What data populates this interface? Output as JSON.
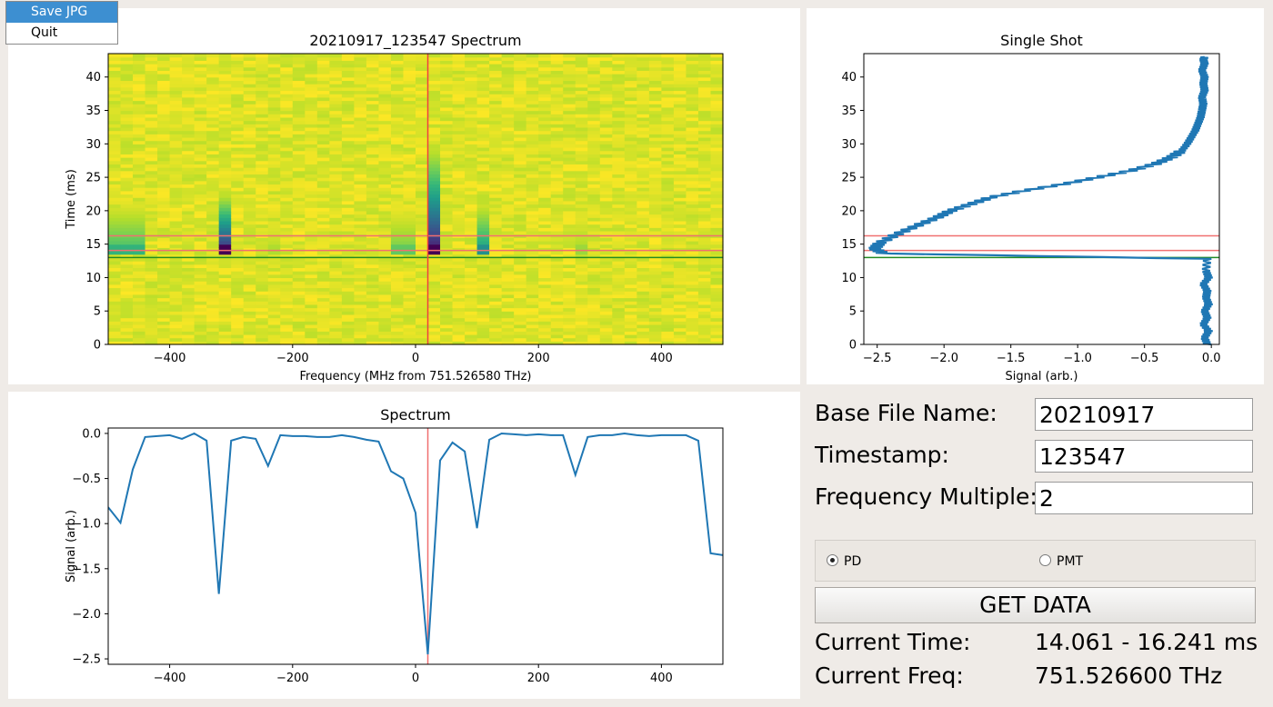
{
  "menu": {
    "items": [
      {
        "label": "Save JPG",
        "active": true
      },
      {
        "label": "Quit",
        "active": false
      }
    ]
  },
  "form": {
    "base_file_name": {
      "label": "Base File Name:",
      "value": "20210917"
    },
    "timestamp": {
      "label": "Timestamp:",
      "value": "123547"
    },
    "frequency_multiple": {
      "label": "Frequency Multiple:",
      "value": "2"
    }
  },
  "detector": {
    "options": [
      {
        "label": "PD",
        "selected": true
      },
      {
        "label": "PMT",
        "selected": false
      }
    ]
  },
  "get_data_label": "GET DATA",
  "status": {
    "time": {
      "label": "Current Time:",
      "value": "14.061 - 16.241 ms"
    },
    "freq": {
      "label": "Current Freq:",
      "value": "751.526600 THz"
    }
  },
  "chart_data": [
    {
      "type": "heatmap",
      "title": "20210917_123547 Spectrum",
      "xlabel": "Frequency (MHz from 751.526580 THz)",
      "ylabel": "Time (ms)",
      "xlim": [
        -500,
        500
      ],
      "ylim": [
        0,
        43.5
      ],
      "xticks": [
        -400,
        -200,
        0,
        200,
        400
      ],
      "yticks": [
        0,
        5,
        10,
        15,
        20,
        25,
        30,
        35,
        40
      ],
      "colormap": "viridis",
      "features": [
        {
          "x_center": -470,
          "width": 40,
          "depth": 0.35,
          "t_end": 23
        },
        {
          "x_center": -310,
          "width": 20,
          "depth": 1.0,
          "t_end": 24
        },
        {
          "x_center": -235,
          "width": 20,
          "depth": 0.12,
          "t_end": 22
        },
        {
          "x_center": -15,
          "width": 40,
          "depth": 0.25,
          "t_end": 22
        },
        {
          "x_center": 25,
          "width": 20,
          "depth": 1.0,
          "t_end": 32
        },
        {
          "x_center": 105,
          "width": 20,
          "depth": 0.5,
          "t_end": 23
        },
        {
          "x_center": 270,
          "width": 20,
          "depth": 0.15,
          "t_end": 22
        }
      ],
      "hlines": [
        {
          "y": 16.24,
          "color": "#f07070"
        },
        {
          "y": 14.06,
          "color": "#f07070"
        },
        {
          "y": 13.0,
          "color": "#228b22"
        }
      ],
      "vlines": [
        {
          "x": 20,
          "color": "#f04040"
        }
      ]
    },
    {
      "type": "line",
      "title": "Single Shot",
      "xlabel": "Signal (arb.)",
      "ylabel": "",
      "xlim": [
        -2.6,
        0.06
      ],
      "ylim": [
        0,
        43.5
      ],
      "xticks": [
        -2.5,
        -2.0,
        -1.5,
        -1.0,
        -0.5,
        0.0
      ],
      "yticks": [
        0,
        5,
        10,
        15,
        20,
        25,
        30,
        35,
        40
      ],
      "series": [
        {
          "x": [
            -0.03,
            -0.05,
            -0.02,
            -0.06,
            -0.03,
            -0.05,
            -0.02,
            -0.04,
            -0.03,
            -0.06,
            -0.02,
            -0.04,
            -0.03,
            -2.45,
            -2.52,
            -2.48,
            -2.35,
            -2.2,
            -2.05,
            -1.95,
            -1.8,
            -1.65,
            -1.4,
            -1.1,
            -0.85,
            -0.6,
            -0.42,
            -0.3,
            -0.22,
            -0.18,
            -0.15,
            -0.12,
            -0.1,
            -0.08,
            -0.07,
            -0.06,
            -0.07,
            -0.05,
            -0.06,
            -0.05,
            -0.07,
            -0.05,
            -0.06,
            -0.05
          ],
          "y": [
            0,
            1,
            2,
            3,
            4,
            5,
            6,
            7,
            8,
            9,
            10,
            11,
            12.8,
            13.6,
            14.3,
            15.2,
            16.5,
            17.8,
            19,
            20,
            21,
            22,
            23,
            24,
            25,
            26,
            27,
            28,
            29,
            30,
            31,
            32,
            33,
            34,
            35,
            36,
            37,
            38,
            39,
            40,
            41,
            42,
            42.6,
            43
          ]
        }
      ],
      "hlines": [
        {
          "y": 16.24,
          "color": "#f07070"
        },
        {
          "y": 14.06,
          "color": "#f07070"
        },
        {
          "y": 13.0,
          "color": "#228b22"
        }
      ]
    },
    {
      "type": "line",
      "title": "Spectrum",
      "xlabel": "",
      "ylabel": "Signal (arb.)",
      "xlim": [
        -500,
        500
      ],
      "ylim": [
        -2.56,
        0.06
      ],
      "xticks": [
        -400,
        -200,
        0,
        200,
        400
      ],
      "yticks": [
        0.0,
        -0.5,
        -1.0,
        -1.5,
        -2.0,
        -2.5
      ],
      "series": [
        {
          "x": [
            -500,
            -480,
            -460,
            -440,
            -420,
            -400,
            -380,
            -360,
            -340,
            -320,
            -300,
            -280,
            -260,
            -240,
            -220,
            -200,
            -180,
            -160,
            -140,
            -120,
            -100,
            -80,
            -60,
            -40,
            -20,
            0,
            20,
            40,
            60,
            80,
            100,
            120,
            140,
            160,
            180,
            200,
            220,
            240,
            260,
            280,
            300,
            320,
            340,
            360,
            380,
            400,
            420,
            440,
            460,
            480,
            500
          ],
          "y": [
            -0.82,
            -0.99,
            -0.4,
            -0.04,
            -0.03,
            -0.02,
            -0.06,
            0.0,
            -0.08,
            -1.78,
            -0.08,
            -0.04,
            -0.06,
            -0.36,
            -0.02,
            -0.03,
            -0.03,
            -0.04,
            -0.04,
            -0.02,
            -0.04,
            -0.07,
            -0.09,
            -0.42,
            -0.5,
            -0.88,
            -2.45,
            -0.3,
            -0.1,
            -0.2,
            -1.05,
            -0.07,
            0.0,
            -0.01,
            -0.02,
            -0.01,
            -0.02,
            -0.02,
            -0.46,
            -0.04,
            -0.02,
            -0.02,
            0.0,
            -0.02,
            -0.03,
            -0.02,
            -0.02,
            -0.02,
            -0.08,
            -1.33,
            -1.35
          ]
        }
      ],
      "vlines": [
        {
          "x": 20,
          "color": "#f07070"
        }
      ]
    }
  ]
}
